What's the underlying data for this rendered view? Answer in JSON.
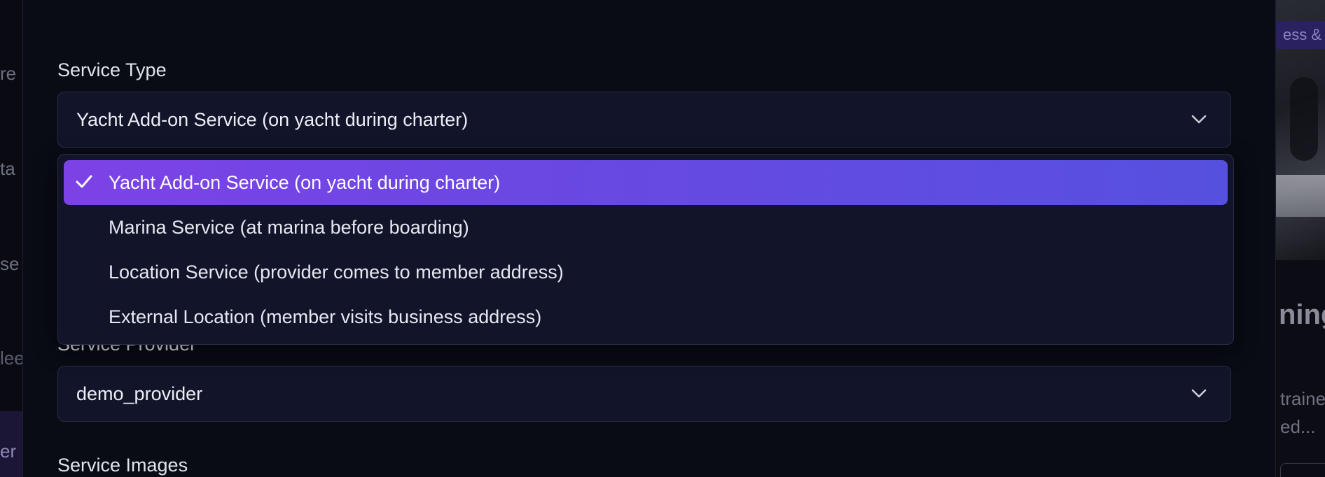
{
  "background": {
    "left_fragments": [
      "re",
      "ta",
      "se",
      "lee",
      "er"
    ],
    "right_badge": "ess &",
    "right_heading": "ning",
    "right_desc": [
      "traine",
      "ed..."
    ]
  },
  "form": {
    "service_type": {
      "label": "Service Type",
      "value": "Yacht Add-on Service (on yacht during charter)",
      "options": [
        {
          "label": "Yacht Add-on Service (on yacht during charter)",
          "selected": true
        },
        {
          "label": "Marina Service (at marina before boarding)",
          "selected": false
        },
        {
          "label": "Location Service (provider comes to member address)",
          "selected": false
        },
        {
          "label": "External Location (member visits business address)",
          "selected": false
        }
      ]
    },
    "service_provider": {
      "label": "Service Provider",
      "value": "demo_provider"
    },
    "service_images": {
      "label": "Service Images"
    }
  },
  "icons": {
    "chevron": "chevron-down-icon",
    "check": "check-icon"
  },
  "colors": {
    "accent_start": "#7d42e6",
    "accent_end": "#5650df",
    "modal_bg": "#090b15",
    "field_bg": "#12152a"
  }
}
